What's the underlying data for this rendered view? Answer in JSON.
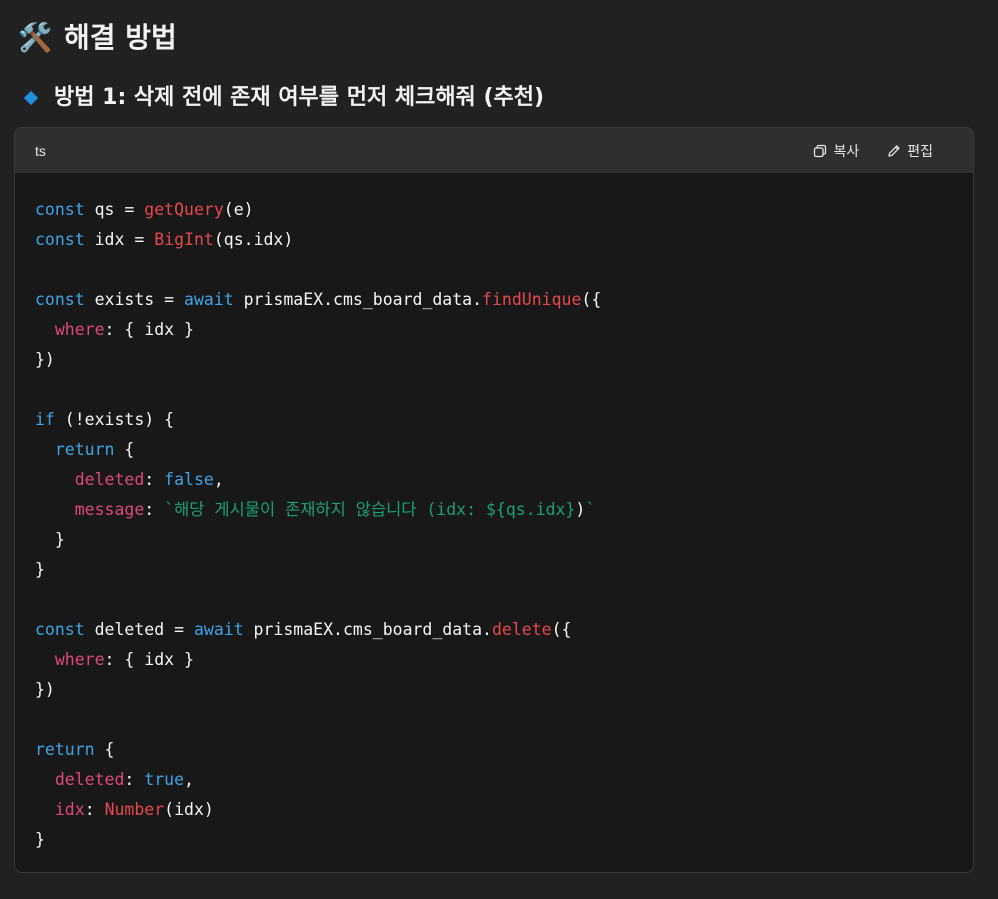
{
  "heading": {
    "emoji": "🛠️",
    "title": "해결 방법"
  },
  "subheading": {
    "title": "방법 1: 삭제 전에 존재 여부를 먼저 체크해줘 (추천)"
  },
  "codebox": {
    "language": "ts",
    "copy_label": "복사",
    "edit_label": "편집",
    "copy_icon": "copy-icon",
    "edit_icon": "pencil-icon"
  },
  "code_lines": [
    [
      [
        "kw",
        "const"
      ],
      [
        "plain",
        " qs = "
      ],
      [
        "fn",
        "getQuery"
      ],
      [
        "plain",
        "(e)"
      ]
    ],
    [
      [
        "kw",
        "const"
      ],
      [
        "plain",
        " idx = "
      ],
      [
        "fn",
        "BigInt"
      ],
      [
        "plain",
        "(qs.idx)"
      ]
    ],
    [],
    [
      [
        "kw",
        "const"
      ],
      [
        "plain",
        " exists = "
      ],
      [
        "kw",
        "await"
      ],
      [
        "plain",
        " prismaEX.cms_board_data."
      ],
      [
        "fn",
        "findUnique"
      ],
      [
        "plain",
        "({"
      ]
    ],
    [
      [
        "plain",
        "  "
      ],
      [
        "prop",
        "where"
      ],
      [
        "plain",
        ": { idx }"
      ]
    ],
    [
      [
        "plain",
        "})"
      ]
    ],
    [],
    [
      [
        "kw",
        "if"
      ],
      [
        "plain",
        " (!exists) {"
      ]
    ],
    [
      [
        "plain",
        "  "
      ],
      [
        "kw",
        "return"
      ],
      [
        "plain",
        " {"
      ]
    ],
    [
      [
        "plain",
        "    "
      ],
      [
        "prop",
        "deleted"
      ],
      [
        "plain",
        ": "
      ],
      [
        "bool",
        "false"
      ],
      [
        "plain",
        ","
      ]
    ],
    [
      [
        "plain",
        "    "
      ],
      [
        "prop",
        "message"
      ],
      [
        "plain",
        ": "
      ],
      [
        "str",
        "`해당 게시물이 존재하지 않습니다 (idx: ${qs.idx}"
      ],
      [
        "plain",
        ")"
      ],
      [
        "str",
        "`"
      ]
    ],
    [
      [
        "plain",
        "  }"
      ]
    ],
    [
      [
        "plain",
        "}"
      ]
    ],
    [],
    [
      [
        "kw",
        "const"
      ],
      [
        "plain",
        " deleted = "
      ],
      [
        "kw",
        "await"
      ],
      [
        "plain",
        " prismaEX.cms_board_data."
      ],
      [
        "fn",
        "delete"
      ],
      [
        "plain",
        "({"
      ]
    ],
    [
      [
        "plain",
        "  "
      ],
      [
        "prop",
        "where"
      ],
      [
        "plain",
        ": { idx }"
      ]
    ],
    [
      [
        "plain",
        "})"
      ]
    ],
    [],
    [
      [
        "kw",
        "return"
      ],
      [
        "plain",
        " {"
      ]
    ],
    [
      [
        "plain",
        "  "
      ],
      [
        "prop",
        "deleted"
      ],
      [
        "plain",
        ": "
      ],
      [
        "bool",
        "true"
      ],
      [
        "plain",
        ","
      ]
    ],
    [
      [
        "plain",
        "  "
      ],
      [
        "prop",
        "idx"
      ],
      [
        "plain",
        ": "
      ],
      [
        "fn",
        "Number"
      ],
      [
        "plain",
        "(idx)"
      ]
    ],
    [
      [
        "plain",
        "}"
      ]
    ]
  ]
}
